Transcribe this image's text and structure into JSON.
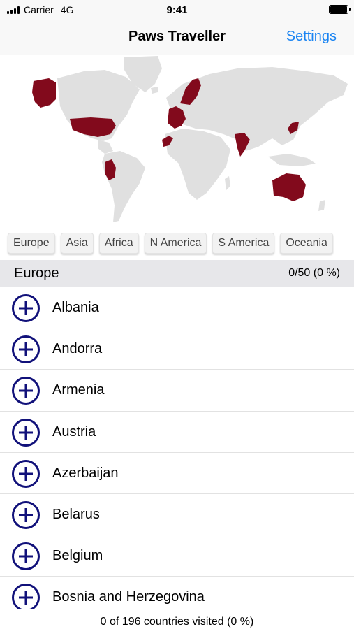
{
  "status": {
    "carrier": "Carrier",
    "network": "4G",
    "time": "9:41"
  },
  "nav": {
    "title": "Paws Traveller",
    "settings_label": "Settings"
  },
  "map": {
    "visited_color": "#820a1c",
    "land_color": "#e0e0e0",
    "highlighted_regions": [
      "Alaska",
      "United States",
      "Peru",
      "Scandinavia",
      "Western Europe",
      "Morocco",
      "India",
      "Japan",
      "Australia"
    ]
  },
  "region_tabs": [
    "Europe",
    "Asia",
    "Africa",
    "N America",
    "S America",
    "Oceania"
  ],
  "section": {
    "title": "Europe",
    "count": "0/50 (0 %)"
  },
  "countries": [
    "Albania",
    "Andorra",
    "Armenia",
    "Austria",
    "Azerbaijan",
    "Belarus",
    "Belgium",
    "Bosnia and Herzegovina"
  ],
  "footer": {
    "summary": "0 of 196 countries visited (0 %)"
  },
  "colors": {
    "accent": "#1a84f2",
    "add_icon": "#11117a"
  }
}
